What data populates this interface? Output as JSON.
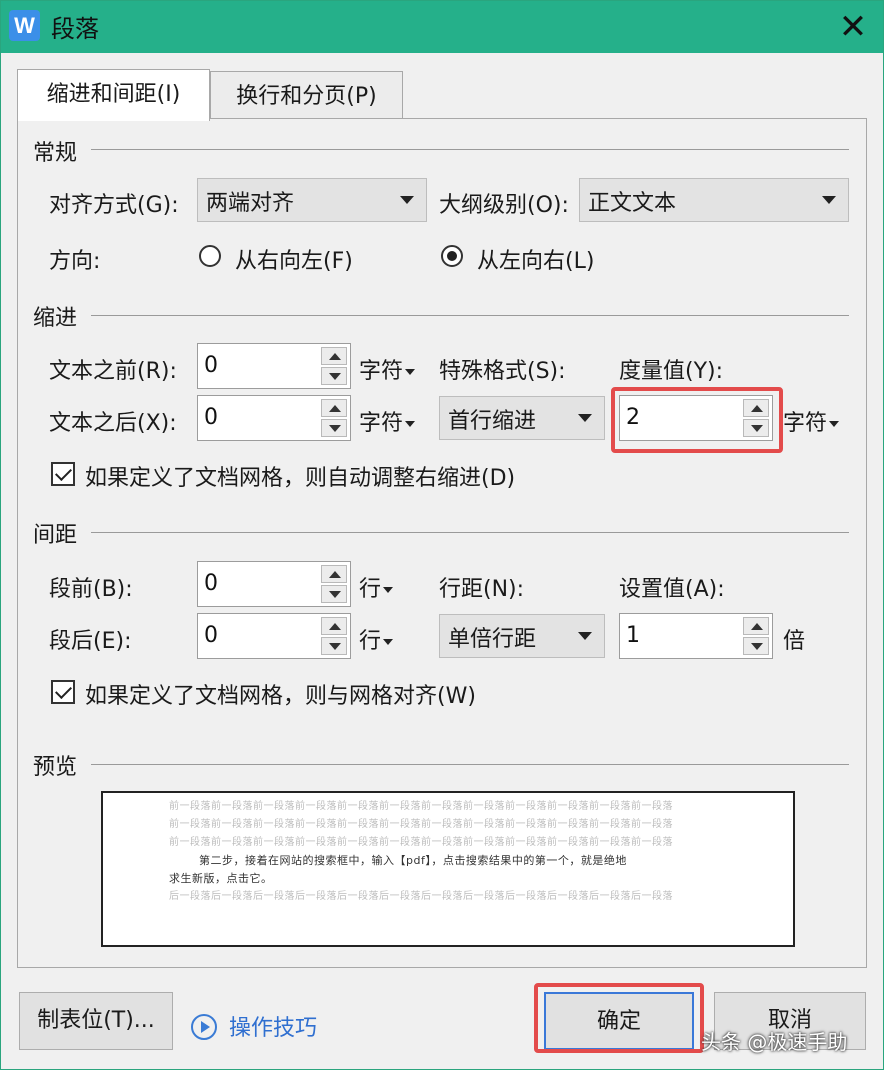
{
  "window": {
    "title": "段落",
    "app_icon": "W"
  },
  "tabs": [
    {
      "label": "缩进和间距(I)"
    },
    {
      "label": "换行和分页(P)"
    }
  ],
  "general": {
    "section": "常规",
    "align_label": "对齐方式(G):",
    "align_value": "两端对齐",
    "outline_label": "大纲级别(O):",
    "outline_value": "正文文本",
    "direction_label": "方向:",
    "rtl_label": "从右向左(F)",
    "ltr_label": "从左向右(L)"
  },
  "indent": {
    "section": "缩进",
    "before_label": "文本之前(R):",
    "before_value": "0",
    "after_label": "文本之后(X):",
    "after_value": "0",
    "unit": "字符",
    "special_label": "特殊格式(S):",
    "special_value": "首行缩进",
    "measure_label": "度量值(Y):",
    "measure_value": "2",
    "measure_unit": "字符",
    "auto_adjust_label": "如果定义了文档网格，则自动调整右缩进(D)"
  },
  "spacing": {
    "section": "间距",
    "before_label": "段前(B):",
    "before_value": "0",
    "after_label": "段后(E):",
    "after_value": "0",
    "unit": "行",
    "line_label": "行距(N):",
    "line_value": "单倍行距",
    "set_label": "设置值(A):",
    "set_value": "1",
    "set_unit": "倍",
    "grid_label": "如果定义了文档网格，则与网格对齐(W)"
  },
  "preview": {
    "section": "预览",
    "filler": "前一段落前一段落前一段落前一段落前一段落前一段落前一段落前一段落前一段落前一段落前一段落前一段落",
    "text_line1": "第二步，接着在网站的搜索框中，输入【pdf】，点击搜索结果中的第一个，就是绝地",
    "text_line2": "求生新版，点击它。",
    "after_filler": "后一段落后一段落后一段落后一段落后一段落后一段落后一段落后一段落后一段落后一段落后一段落后一段落"
  },
  "footer": {
    "tabs_button": "制表位(T)...",
    "tips_link": "操作技巧",
    "ok_button": "确定",
    "cancel_button": "取消",
    "watermark": "头条 @极速手助"
  }
}
